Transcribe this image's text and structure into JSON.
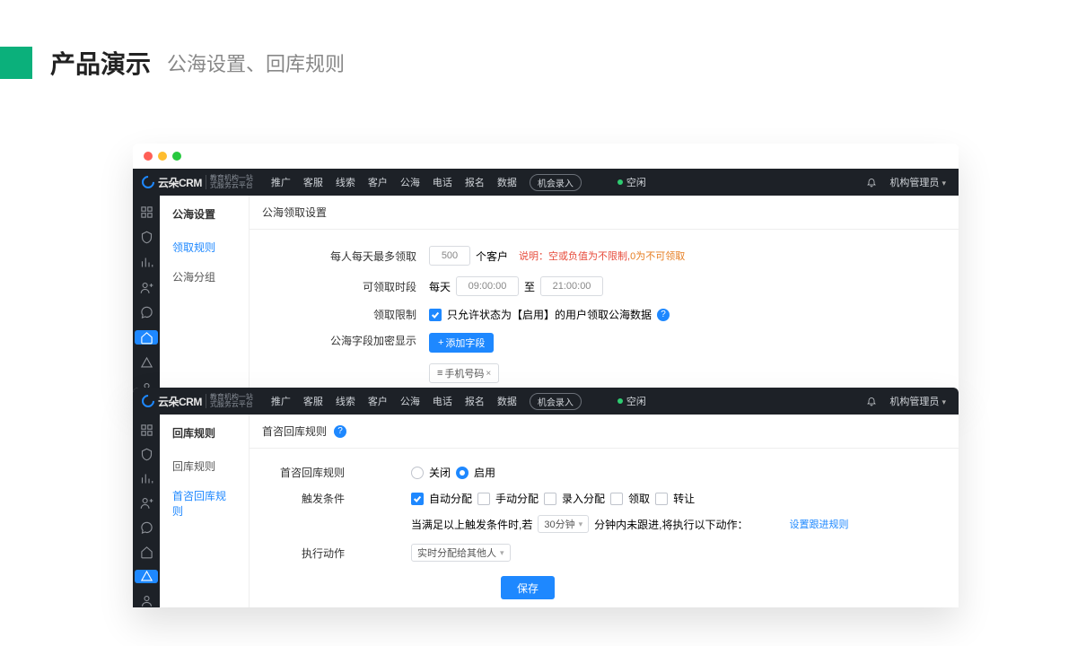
{
  "slide": {
    "title": "产品演示",
    "subtitle": "公海设置、回库规则"
  },
  "common": {
    "logo_text": "云朵CRM",
    "logo_sub1": "教育机构一站",
    "logo_sub2": "式服务云平台",
    "nav": [
      "推广",
      "客服",
      "线索",
      "客户",
      "公海",
      "电话",
      "报名",
      "数据"
    ],
    "nav_pill": "机会录入",
    "status": "空闲",
    "user": "机构管理员"
  },
  "win1": {
    "side_title": "公海设置",
    "side_items": [
      "领取规则",
      "公海分组"
    ],
    "side_active": 0,
    "content_title": "公海领取设置",
    "rows": {
      "max_label": "每人每天最多领取",
      "max_value": "500",
      "max_unit": "个客户",
      "max_hint_prefix": "说明：",
      "max_hint": "空或负值为不限制,",
      "max_hint_zero": "0为不可领取",
      "time_label": "可领取时段",
      "time_daily": "每天",
      "time_start": "09:00:00",
      "time_sep": "至",
      "time_end": "21:00:00",
      "limit_label": "领取限制",
      "limit_text": "只允许状态为【启用】的用户领取公海数据",
      "enc_label": "公海字段加密显示",
      "enc_btn": "添加字段",
      "enc_tag_icon": "≡",
      "enc_tag": "手机号码"
    }
  },
  "win2": {
    "side_title": "回库规则",
    "side_items": [
      "回库规则",
      "首咨回库规则"
    ],
    "side_active": 1,
    "content_title": "首咨回库规则",
    "rows": {
      "rule_label": "首咨回库规则",
      "off": "关闭",
      "on": "启用",
      "trig_label": "触发条件",
      "trig_opts": [
        "自动分配",
        "手动分配",
        "录入分配",
        "领取",
        "转让"
      ],
      "trig_checked": [
        true,
        false,
        false,
        false,
        false
      ],
      "cond_prefix": "当满足以上触发条件时,若",
      "cond_minutes": "30分钟",
      "cond_suffix": "分钟内未跟进,将执行以下动作：",
      "cond_link": "设置跟进规则",
      "action_label": "执行动作",
      "action_value": "实时分配给其他人",
      "save": "保存"
    }
  }
}
